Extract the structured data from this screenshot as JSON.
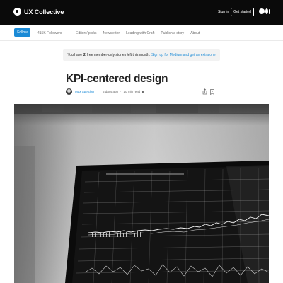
{
  "header": {
    "brand": "UX Collective",
    "sign_in": "Sign in",
    "get_started": "Get started",
    "medium_logo_icon": "medium-logo-icon"
  },
  "nav": {
    "follow": "Follow",
    "followers": "415K Followers",
    "items": [
      "Editors' picks",
      "Newsletter",
      "Leading with Craft",
      "Publish a story",
      "About"
    ]
  },
  "notice": {
    "prefix": "You have",
    "count": "2",
    "middle": "free member-only stories left this month.",
    "link": "Sign up for Medium and get an extra one"
  },
  "article": {
    "title": "KPI-centered design",
    "author": "Max Speicher",
    "date": "5 days ago",
    "read_time": "10 min read",
    "separator": "·"
  },
  "colors": {
    "topbar": "#0a0a0a",
    "accent": "#1a8ad6",
    "banner_bg": "#f2f2f2"
  }
}
